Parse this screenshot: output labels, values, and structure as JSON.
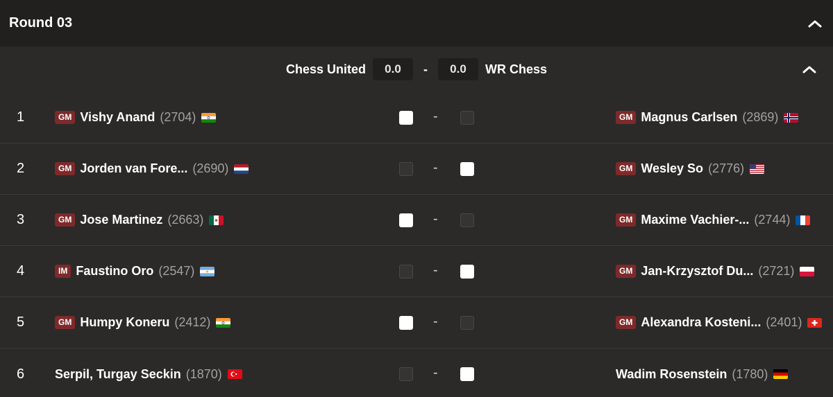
{
  "round": {
    "title": "Round 03"
  },
  "match": {
    "home_team": "Chess United",
    "home_score": "0.0",
    "separator": "-",
    "away_score": "0.0",
    "away_team": "WR Chess"
  },
  "boards": [
    {
      "num": "1",
      "left": {
        "title": "GM",
        "name": "Vishy Anand",
        "rating": "(2704)",
        "flag": "india"
      },
      "result_left": "win",
      "result_right": "empty",
      "dash": "-",
      "right": {
        "title": "GM",
        "name": "Magnus Carlsen",
        "rating": "(2869)",
        "flag": "norway"
      }
    },
    {
      "num": "2",
      "left": {
        "title": "GM",
        "name": "Jorden van Fore...",
        "rating": "(2690)",
        "flag": "netherlands"
      },
      "result_left": "empty",
      "result_right": "win",
      "dash": "-",
      "right": {
        "title": "GM",
        "name": "Wesley So",
        "rating": "(2776)",
        "flag": "usa"
      }
    },
    {
      "num": "3",
      "left": {
        "title": "GM",
        "name": "Jose Martinez",
        "rating": "(2663)",
        "flag": "mexico"
      },
      "result_left": "win",
      "result_right": "empty",
      "dash": "-",
      "right": {
        "title": "GM",
        "name": "Maxime Vachier-...",
        "rating": "(2744)",
        "flag": "france"
      }
    },
    {
      "num": "4",
      "left": {
        "title": "IM",
        "name": "Faustino Oro",
        "rating": "(2547)",
        "flag": "argentina"
      },
      "result_left": "empty",
      "result_right": "win",
      "dash": "-",
      "right": {
        "title": "GM",
        "name": "Jan-Krzysztof Du...",
        "rating": "(2721)",
        "flag": "poland"
      }
    },
    {
      "num": "5",
      "left": {
        "title": "GM",
        "name": "Humpy Koneru",
        "rating": "(2412)",
        "flag": "india"
      },
      "result_left": "win",
      "result_right": "empty",
      "dash": "-",
      "right": {
        "title": "GM",
        "name": "Alexandra Kosteni...",
        "rating": "(2401)",
        "flag": "switzerland"
      }
    },
    {
      "num": "6",
      "left": {
        "title": "",
        "name": "Serpil, Turgay Seckin",
        "rating": "(1870)",
        "flag": "turkey"
      },
      "result_left": "empty",
      "result_right": "win",
      "dash": "-",
      "right": {
        "title": "",
        "name": "Wadim Rosenstein",
        "rating": "(1780)",
        "flag": "germany"
      }
    }
  ],
  "colors": {
    "title_badge": "#7e2a2a",
    "background": "#2b2a29",
    "header": "#21201e",
    "rating": "#a3a2a0"
  }
}
